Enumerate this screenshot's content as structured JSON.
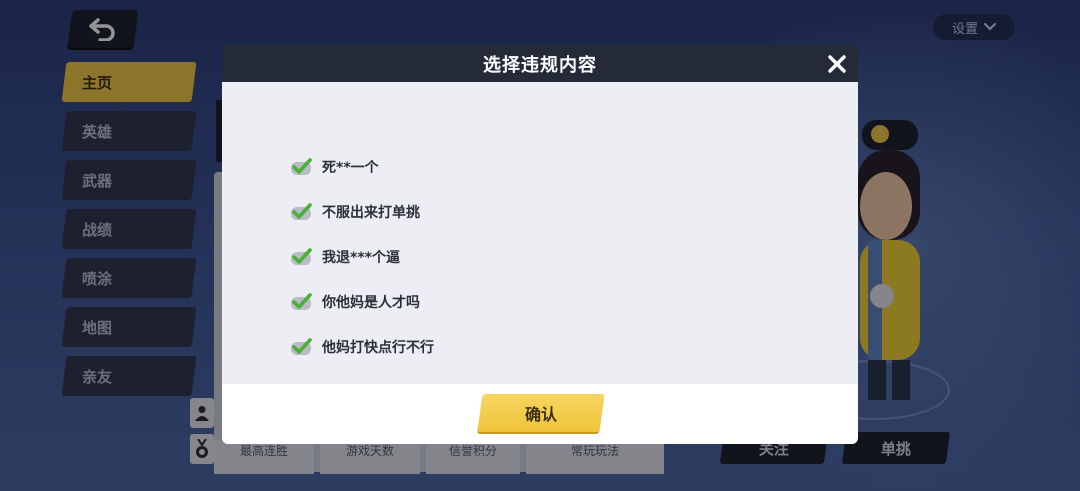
{
  "header": {
    "settings_label": "设置"
  },
  "sidebar": {
    "items": [
      {
        "label": "主页",
        "active": true
      },
      {
        "label": "英雄",
        "active": false
      },
      {
        "label": "武器",
        "active": false
      },
      {
        "label": "战绩",
        "active": false
      },
      {
        "label": "喷涂",
        "active": false
      },
      {
        "label": "地图",
        "active": false
      },
      {
        "label": "亲友",
        "active": false
      }
    ]
  },
  "background": {
    "stats": [
      "最高连胜",
      "游戏天数",
      "信誉积分",
      "常玩玩法"
    ],
    "follow_label": "关注",
    "challenge_label": "单挑"
  },
  "dialog": {
    "title": "选择违规内容",
    "options": [
      {
        "label": "死**一个",
        "checked": true
      },
      {
        "label": "不服出来打单挑",
        "checked": true
      },
      {
        "label": "我退***个逼",
        "checked": true
      },
      {
        "label": "你他妈是人才吗",
        "checked": true
      },
      {
        "label": "他妈打快点行不行",
        "checked": true
      }
    ],
    "confirm_label": "确认"
  },
  "colors": {
    "accent": "#f2c94a",
    "check_green": "#4caf3a",
    "header_dark": "#252a38"
  },
  "icons": {
    "back": "back-arrow-icon",
    "settings_chevron": "chevron-down-icon",
    "close": "close-icon",
    "check": "checkbox-checked-icon"
  }
}
